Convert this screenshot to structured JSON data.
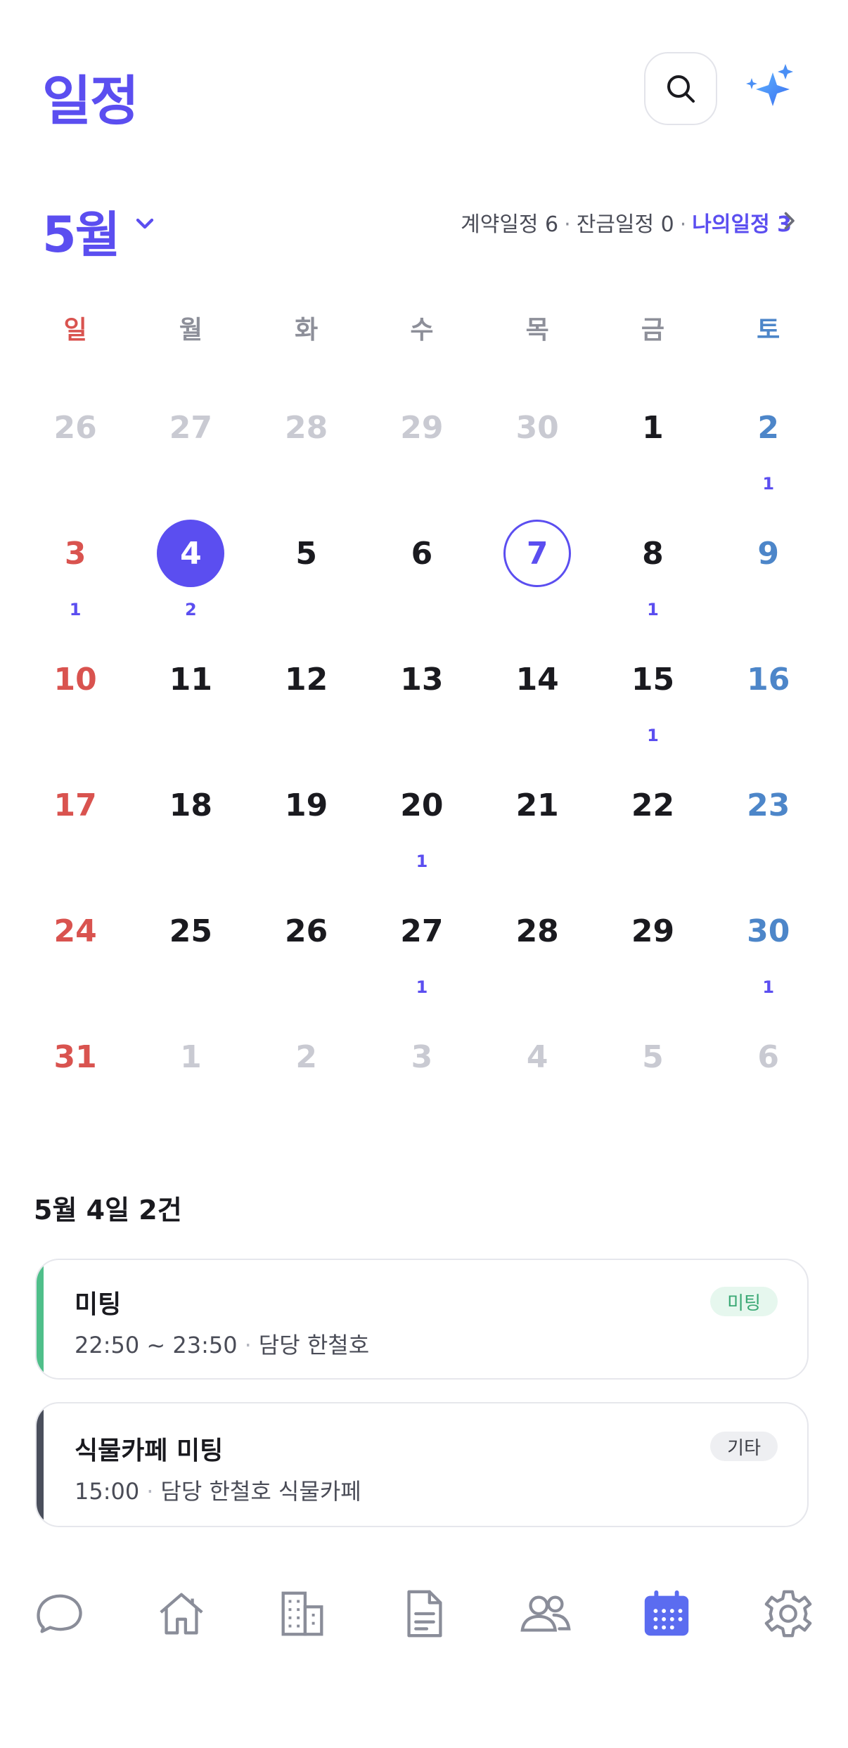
{
  "header": {
    "title": "일정"
  },
  "month_row": {
    "month": "5월",
    "summary_contract": "계약일정 6",
    "summary_balance": "잔금일정 0",
    "summary_mine": "나의일정 3"
  },
  "weekdays": [
    "일",
    "월",
    "화",
    "수",
    "목",
    "금",
    "토"
  ],
  "weeks": [
    [
      {
        "d": "26",
        "t": "muted"
      },
      {
        "d": "27",
        "t": "muted"
      },
      {
        "d": "28",
        "t": "muted"
      },
      {
        "d": "29",
        "t": "muted"
      },
      {
        "d": "30",
        "t": "muted"
      },
      {
        "d": "1",
        "t": ""
      },
      {
        "d": "2",
        "t": "sat",
        "c": "1"
      }
    ],
    [
      {
        "d": "3",
        "t": "sun",
        "c": "1"
      },
      {
        "d": "4",
        "t": "selected",
        "c": "2"
      },
      {
        "d": "5",
        "t": ""
      },
      {
        "d": "6",
        "t": ""
      },
      {
        "d": "7",
        "t": "today"
      },
      {
        "d": "8",
        "t": "",
        "c": "1"
      },
      {
        "d": "9",
        "t": "sat"
      }
    ],
    [
      {
        "d": "10",
        "t": "sun"
      },
      {
        "d": "11",
        "t": ""
      },
      {
        "d": "12",
        "t": ""
      },
      {
        "d": "13",
        "t": ""
      },
      {
        "d": "14",
        "t": ""
      },
      {
        "d": "15",
        "t": "",
        "c": "1"
      },
      {
        "d": "16",
        "t": "sat"
      }
    ],
    [
      {
        "d": "17",
        "t": "sun"
      },
      {
        "d": "18",
        "t": ""
      },
      {
        "d": "19",
        "t": ""
      },
      {
        "d": "20",
        "t": "",
        "c": "1"
      },
      {
        "d": "21",
        "t": ""
      },
      {
        "d": "22",
        "t": ""
      },
      {
        "d": "23",
        "t": "sat"
      }
    ],
    [
      {
        "d": "24",
        "t": "sun"
      },
      {
        "d": "25",
        "t": ""
      },
      {
        "d": "26",
        "t": ""
      },
      {
        "d": "27",
        "t": "",
        "c": "1"
      },
      {
        "d": "28",
        "t": ""
      },
      {
        "d": "29",
        "t": ""
      },
      {
        "d": "30",
        "t": "sat",
        "c": "1"
      }
    ],
    [
      {
        "d": "31",
        "t": "sun"
      },
      {
        "d": "1",
        "t": "muted"
      },
      {
        "d": "2",
        "t": "muted"
      },
      {
        "d": "3",
        "t": "muted"
      },
      {
        "d": "4",
        "t": "muted"
      },
      {
        "d": "5",
        "t": "muted"
      },
      {
        "d": "6",
        "t": "muted"
      }
    ]
  ],
  "day_detail": {
    "title": "5월 4일 2건",
    "events": [
      {
        "title": "미팅",
        "time": "22:50 ~ 23:50",
        "owner": "담당 한철호",
        "tag": "미팅",
        "accent": "#4fbf8a",
        "tag_bg": "#e6f7ee",
        "tag_fg": "#3aa874"
      },
      {
        "title": "식물카페 미팅",
        "time": "15:00",
        "owner": "담당 한철호 식물카페",
        "tag": "기타",
        "accent": "#4a4f5c",
        "tag_bg": "#eeeff2",
        "tag_fg": "#3a3c44"
      }
    ]
  },
  "tabbar": {
    "items": [
      "chat-icon",
      "home-icon",
      "building-icon",
      "document-icon",
      "people-icon",
      "calendar-icon",
      "gear-icon"
    ],
    "active": "calendar-icon",
    "active_color": "#5b4ef0"
  }
}
